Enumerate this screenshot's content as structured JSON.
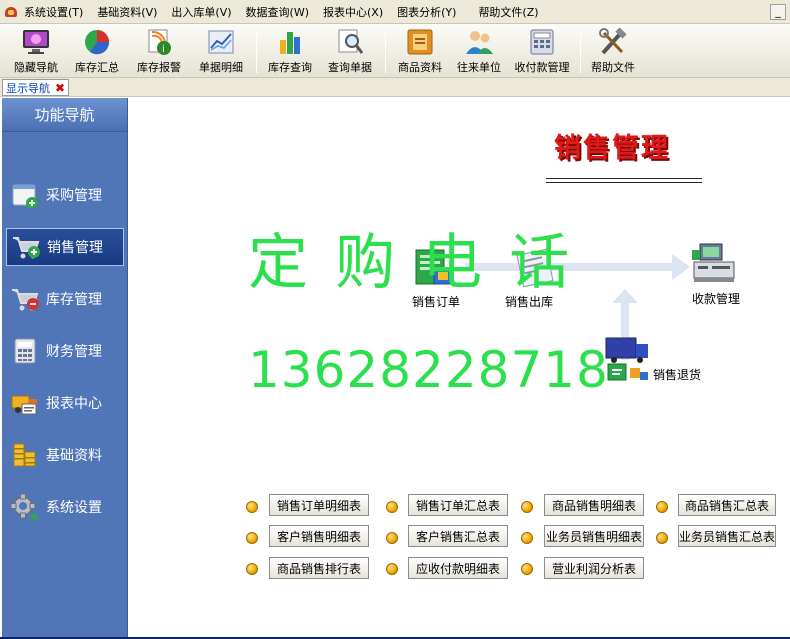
{
  "menubar": {
    "items": [
      "系统设置(T)",
      "基础资料(V)",
      "出入库单(V)",
      "数据查询(W)",
      "报表中心(X)",
      "图表分析(Y)",
      "帮助文件(Z)"
    ],
    "minimize": "_"
  },
  "toolbar": {
    "buttons": [
      {
        "label": "隐藏导航",
        "icon": "monitor-icon"
      },
      {
        "label": "库存汇总",
        "icon": "pie-chart-icon"
      },
      {
        "label": "库存报警",
        "icon": "alert-doc-icon"
      },
      {
        "label": "单据明细",
        "icon": "line-chart-icon"
      },
      {
        "label": "库存查询",
        "icon": "bar-chart-icon"
      },
      {
        "label": "查询单据",
        "icon": "magnifier-doc-icon"
      },
      {
        "label": "商品资料",
        "icon": "box-book-icon"
      },
      {
        "label": "往来单位",
        "icon": "users-icon"
      },
      {
        "label": "收付款管理",
        "icon": "calculator-icon"
      },
      {
        "label": "帮助文件",
        "icon": "tools-icon"
      }
    ]
  },
  "panel": {
    "tab_label": "显示导航",
    "close_glyph": "✖"
  },
  "sidebar": {
    "title": "功能导航",
    "items": [
      {
        "label": "采购管理",
        "icon": "purchase-icon"
      },
      {
        "label": "销售管理",
        "icon": "sales-cart-icon",
        "active": true
      },
      {
        "label": "库存管理",
        "icon": "inventory-cart-icon"
      },
      {
        "label": "财务管理",
        "icon": "calculator-icon"
      },
      {
        "label": "报表中心",
        "icon": "truck-report-icon"
      },
      {
        "label": "基础资料",
        "icon": "coins-icon"
      },
      {
        "label": "系统设置",
        "icon": "gear-icon"
      }
    ]
  },
  "main": {
    "title": "销售管理",
    "flow": {
      "order": "销售订单",
      "outbound": "销售出库",
      "payment": "收款管理",
      "return": "销售退货"
    },
    "watermark": {
      "line1": "定 购 电 话",
      "line2": "13628228718"
    },
    "reports": [
      "销售订单明细表",
      "销售订单汇总表",
      "商品销售明细表",
      "商品销售汇总表",
      "客户销售明细表",
      "客户销售汇总表",
      "业务员销售明细表",
      "业务员销售汇总表",
      "商品销售排行表",
      "应收付款明细表",
      "营业利润分析表"
    ]
  },
  "colors": {
    "sidebar_bg": "#5076b8",
    "title_red": "#e01818",
    "watermark_green": "#2be04c",
    "bullet_orange": "#f0a600"
  }
}
